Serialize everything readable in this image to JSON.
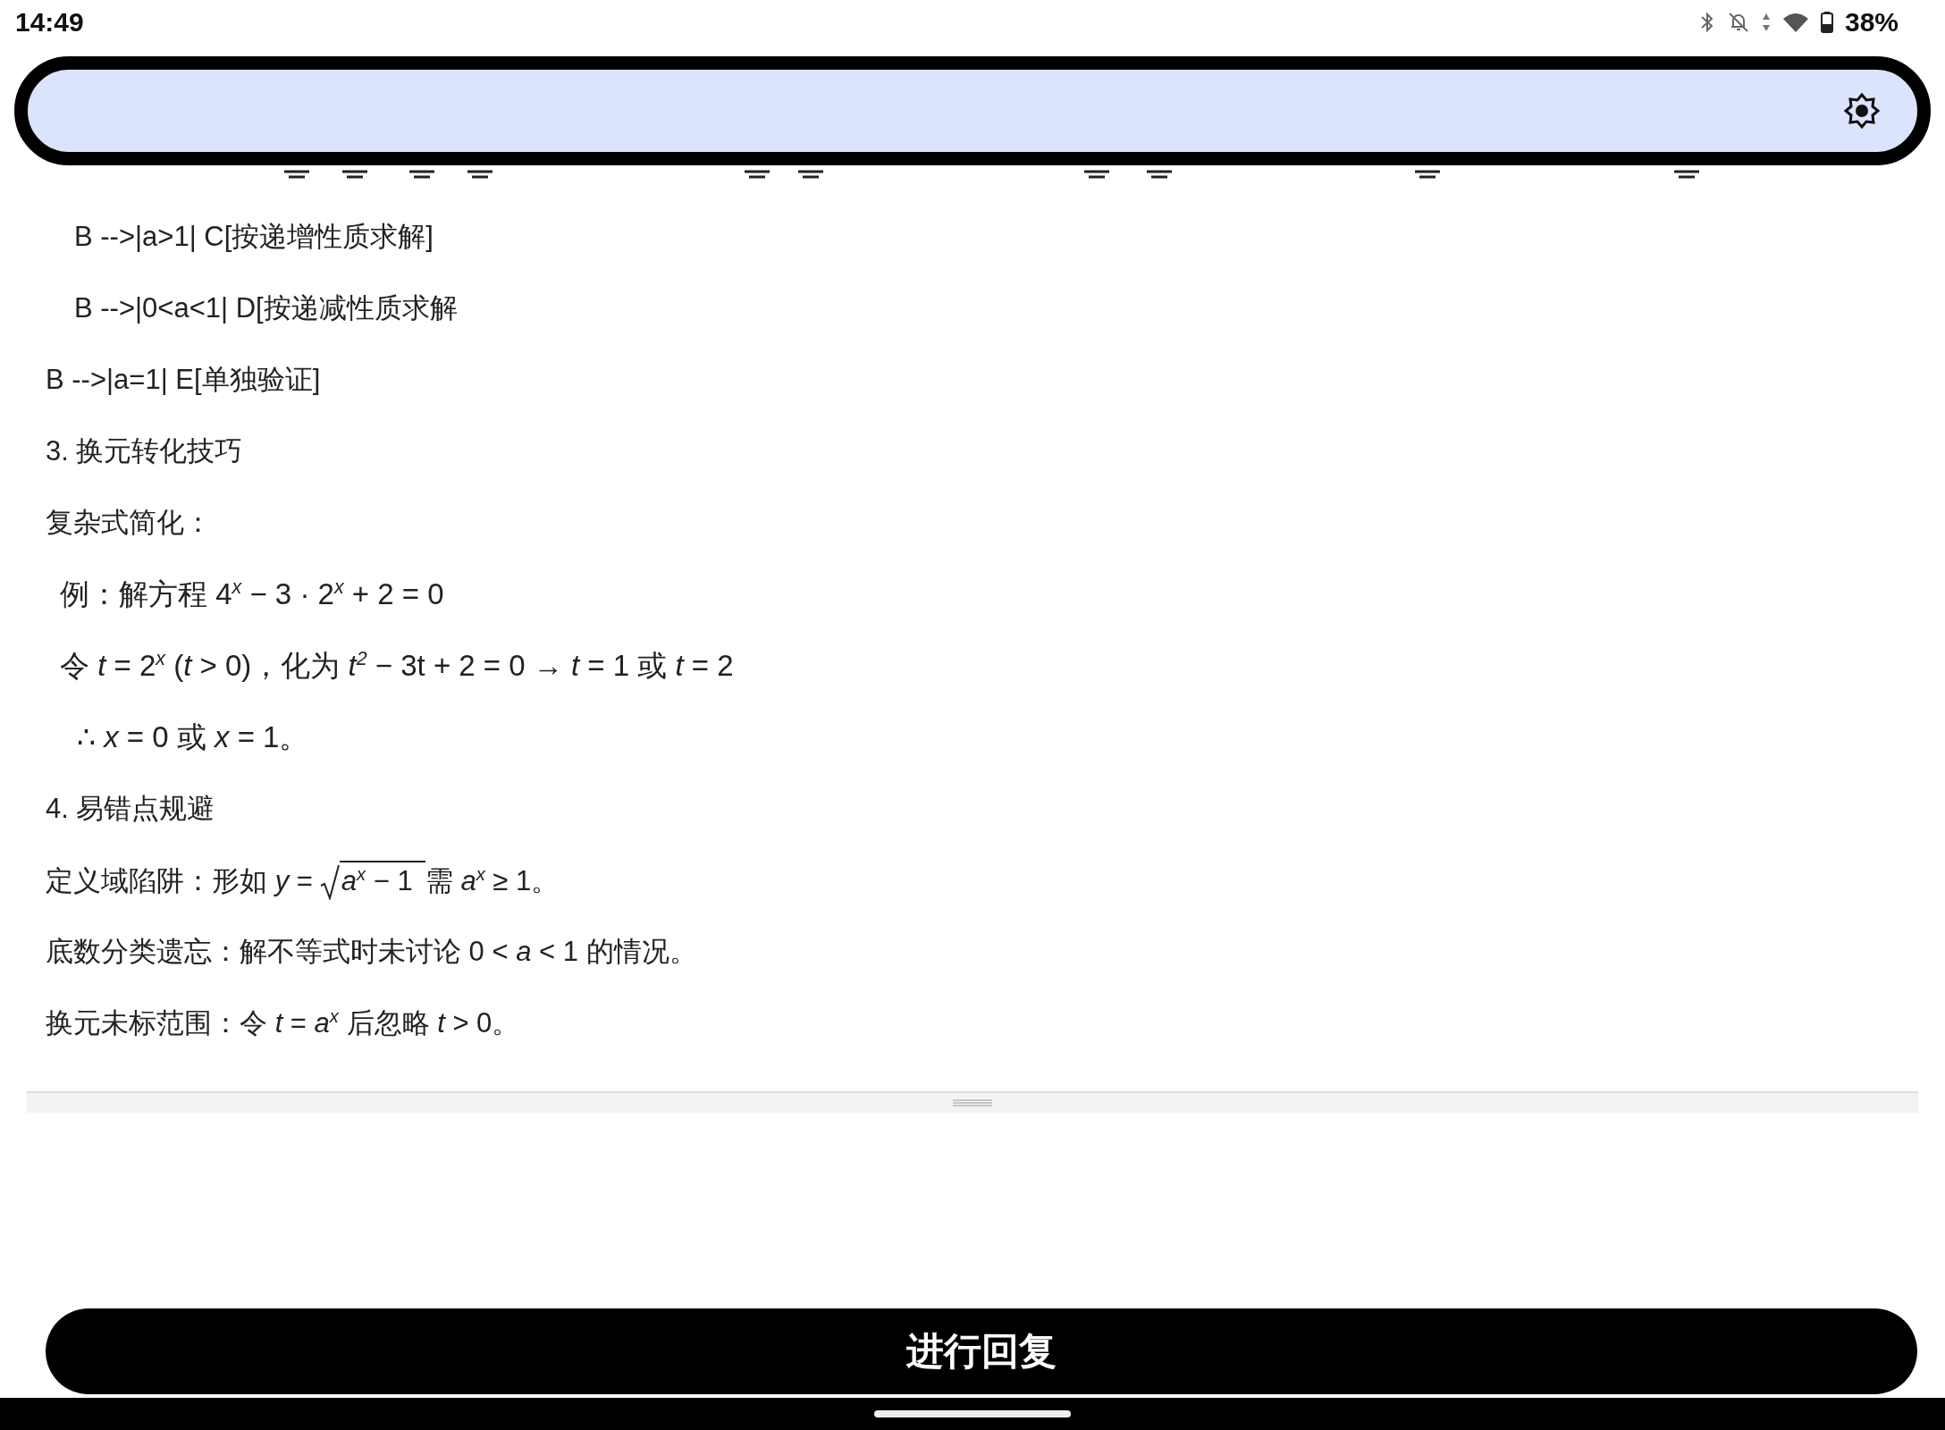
{
  "status_bar": {
    "time": "14:49",
    "battery_percent": "38%"
  },
  "content_lines": [
    {
      "kind": "code_step",
      "text": "B -->|a>1| C[按递增性质求解]"
    },
    {
      "kind": "code_step",
      "text": "B -->|0<a<1| D[按递减性质求解"
    },
    {
      "kind": "text",
      "text": "B -->|a=1| E[单独验证]"
    },
    {
      "kind": "text",
      "text": "3. 换元转化技巧"
    },
    {
      "kind": "text",
      "text": "复杂式简化："
    },
    {
      "kind": "example",
      "text": "例：解方程 4$^{x}$ − 3 · 2$^{x}$ + 2 = 0"
    },
    {
      "kind": "example",
      "text": "令 *t* = 2$^{x}$  (*t* > 0)，化为 *t*$^{2}$ − 3t + 2 = 0 → *t* = 1 或 *t* = 2"
    },
    {
      "kind": "conclusion",
      "text": "∴ *x* = 0 或 *x* = 1。"
    },
    {
      "kind": "text",
      "text": "4. 易错点规避"
    },
    {
      "kind": "sqrt",
      "before": "定义域陷阱：形如 *y* = ",
      "radicand": "*a*$^{x}$ − 1",
      "after": "需 *a*$^{x}$ ≥ 1。"
    },
    {
      "kind": "text",
      "text": "底数分类遗忘：解不等式时未讨论 0 < *a* < 1 的情况。"
    },
    {
      "kind": "text",
      "text": "换元未标范围：令 *t* = *a*$^{x}$ 后忽略 *t* > 0。"
    }
  ],
  "reply_button": {
    "label": "进行回复"
  }
}
